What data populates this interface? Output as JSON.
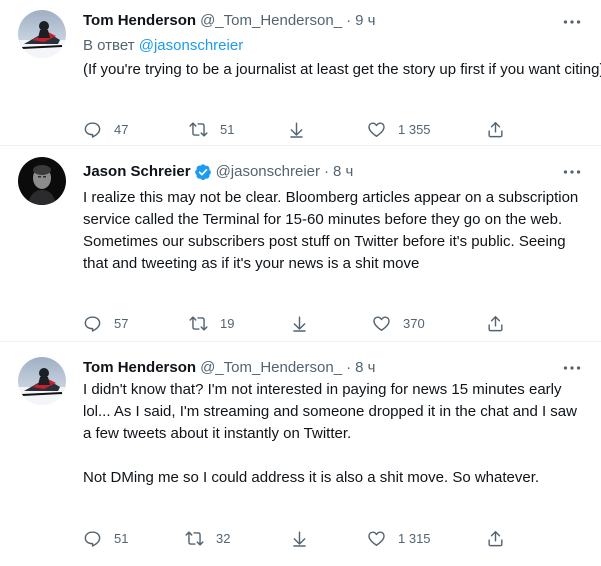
{
  "tweets": [
    {
      "name": "Tom Henderson",
      "handle": "@_Tom_Henderson_",
      "separator": "·",
      "time": "9 ч",
      "reply_prefix": "В ответ",
      "reply_to": "@jasonschreier",
      "text": "(If you're trying to be a journalist at least get the story up first if you want citing)",
      "replies": "47",
      "retweets": "51",
      "likes": "1 355"
    },
    {
      "name": "Jason Schreier",
      "handle": "@jasonschreier",
      "separator": "·",
      "time": "8 ч",
      "verified": true,
      "text": "I realize this may not be clear. Bloomberg articles appear on a subscription service called the Terminal for 15-60 minutes before they go on the web. Sometimes our subscribers post stuff on Twitter before it's public. Seeing that and tweeting as if it's your news is a shit move",
      "replies": "57",
      "retweets": "19",
      "likes": "370"
    },
    {
      "name": "Tom Henderson",
      "handle": "@_Tom_Henderson_",
      "separator": "·",
      "time": "8 ч",
      "text": "I didn't know that? I'm not interested in paying for news 15 minutes early lol... As I said, I'm streaming and someone dropped it in the chat and I saw a few tweets about it instantly on Twitter.\n\nNot DMing me so I could address it is also a shit move. So whatever.",
      "replies": "51",
      "retweets": "32",
      "likes": "1 315"
    }
  ],
  "icons": {
    "reply": "reply-icon",
    "retweet": "retweet-icon",
    "share": "share-icon",
    "like": "heart-icon",
    "upload": "upload-icon",
    "more": "more-icon",
    "verified": "verified-badge-icon"
  },
  "colors": {
    "text": "#0f1419",
    "secondary": "#536471",
    "link": "#1d9bf0",
    "verified": "#1d9bf0",
    "divider": "#eff3f4"
  }
}
